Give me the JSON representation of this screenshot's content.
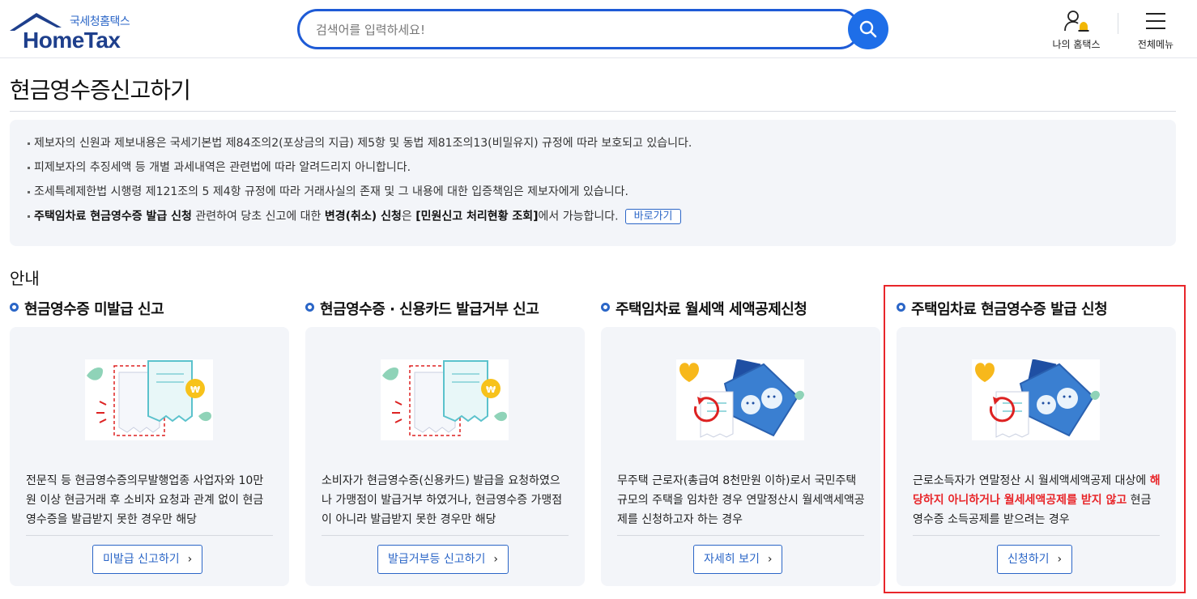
{
  "header": {
    "logo_sub": "국세청홈택스",
    "logo_main": "HomeTax",
    "search_placeholder": "검색어를 입력하세요!",
    "my_hometax": "나의 홈택스",
    "all_menu": "전체메뉴"
  },
  "page": {
    "title": "현금영수증신고하기"
  },
  "notice": {
    "items": [
      "제보자의 신원과 제보내용은 국세기본법 제84조의2(포상금의 지급) 제5항 및 동법 제81조의13(비밀유지) 규정에 따라 보호되고 있습니다.",
      "피제보자의 추징세액 등 개별 과세내역은 관련법에 따라 알려드리지 아니합니다.",
      "조세특례제한법 시행령 제121조의 5 제4항 규정에 따라 거래사실의 존재 및 그 내용에 대한 입증책임은 제보자에게 있습니다."
    ],
    "last": {
      "bold1": "주택임차료 현금영수증 발급 신청",
      "text1": " 관련하여 당초 신고에 대한 ",
      "bold2": "변경(취소) 신청",
      "text2": "은 ",
      "bold3": "[민원신고 처리현황 조회]",
      "text3": "에서 가능합니다.",
      "button": "바로가기"
    }
  },
  "guide": {
    "title": "안내",
    "cards": [
      {
        "heading": "현금영수증 미발급 신고",
        "desc": "전문직 등 현금영수증의무발행업종 사업자와 10만원 이상 현금거래 후 소비자 요청과 관계 없이 현금영수증을 발급받지 못한 경우만 해당",
        "button": "미발급 신고하기"
      },
      {
        "heading": "현금영수증 · 신용카드 발급거부 신고",
        "desc": "소비자가 현금영수증(신용카드) 발급을 요청하였으나 가맹점이 발급거부 하였거나, 현금영수증 가맹점이 아니라 발급받지 못한 경우만 해당",
        "button": "발급거부등 신고하기"
      },
      {
        "heading": "주택임차료 월세액 세액공제신청",
        "desc": "무주택 근로자(총급여 8천만원 이하)로서 국민주택 규모의 주택을 임차한 경우 연말정산시 월세액세액공제를 신청하고자 하는 경우",
        "button": "자세히 보기"
      },
      {
        "heading": "주택임차료 현금영수증 발급 신청",
        "desc_pre": "근로소득자가 연말정산 시 월세액세액공제 대상에 ",
        "desc_red": "해당하지 아니하거나 월세세액공제를 받지 않고",
        "desc_post": " 현금영수증 소득공제를 받으려는 경우",
        "button": "신청하기"
      }
    ]
  },
  "colors": {
    "accent": "#2b66c7",
    "search_border": "#1e5bd6",
    "highlight": "#e8262a",
    "panel_bg": "#f3f5f9"
  },
  "icons": [
    "search-icon",
    "user-bell-icon",
    "hamburger-icon",
    "chevron-right-icon",
    "receipt-illustration",
    "rent-illustration"
  ]
}
